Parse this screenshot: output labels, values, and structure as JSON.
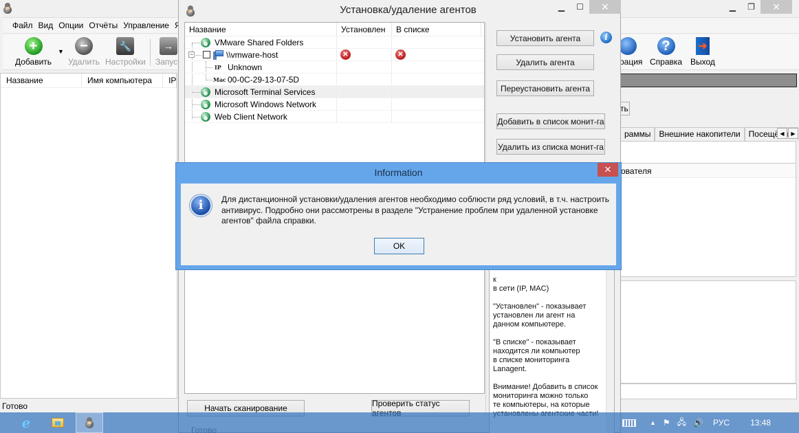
{
  "main_window": {
    "menu": [
      "Файл",
      "Вид",
      "Опции",
      "Отчёты",
      "Управление",
      "Язь"
    ],
    "toolbar": {
      "add": "Добавить",
      "delete": "Удалить",
      "settings": "Настройки",
      "launch": "Запуст",
      "config": "рация",
      "help": "Справка",
      "exit": "Выход"
    },
    "list_columns": [
      "Название",
      "Имя компьютера",
      "IP"
    ],
    "status": "Готово",
    "right_button": "ть",
    "tabs": [
      "раммы",
      "Внешние накопители",
      "Посещённь"
    ],
    "right_header": "ователя"
  },
  "agents_dialog": {
    "title": "Установка/удаление агентов",
    "columns": [
      "Название",
      "Установлен",
      "В списке"
    ],
    "tree": [
      {
        "label": "VMware Shared Folders",
        "type": "network"
      },
      {
        "label": "\\\\vmware-host",
        "type": "computer",
        "installed": "no",
        "in_list": "no",
        "checked": false
      },
      {
        "label": "Unknown",
        "type": "ip",
        "prefix": "IP"
      },
      {
        "label": "00-0C-29-13-07-5D",
        "type": "mac",
        "prefix": "Mac"
      },
      {
        "label": "Microsoft Terminal Services",
        "type": "network",
        "selected": true
      },
      {
        "label": "Microsoft Windows Network",
        "type": "network"
      },
      {
        "label": "Web Client Network",
        "type": "network"
      }
    ],
    "actions": {
      "install": "Установить агента",
      "remove": "Удалить агента",
      "reinstall": "Переустановить агента",
      "add_monitor": "Добавить в список монит-га",
      "remove_monitor": "Удалить из списка монит-га"
    },
    "help_text": "к\nв сети (IP, MAC)\n\n\"Установлен\" - показывает\nустановлен ли агент на\nданном компьютере.\n\n\"В списке\" - показывает\nнаходится ли компьютер\nв списке мониторинга\nLanagent.\n\nВнимание! Добавить в список\nмониторинга можно только\nте компьютеры, на которые\nустановлены агентские части!",
    "scan_button": "Начать сканирование",
    "check_button": "Проверить статус агентов",
    "status": "Готово"
  },
  "info_dialog": {
    "title": "Information",
    "message": "Для дистанционной установки/удаления агентов необходимо соблюсти ряд условий, в т.ч. настроить антивирус. Подробно они рассмотрены в разделе \"Устранение проблем при удаленной установке агентов\" файла справки.",
    "ok": "OK"
  },
  "taskbar": {
    "language": "РУС",
    "time": "13:48"
  }
}
